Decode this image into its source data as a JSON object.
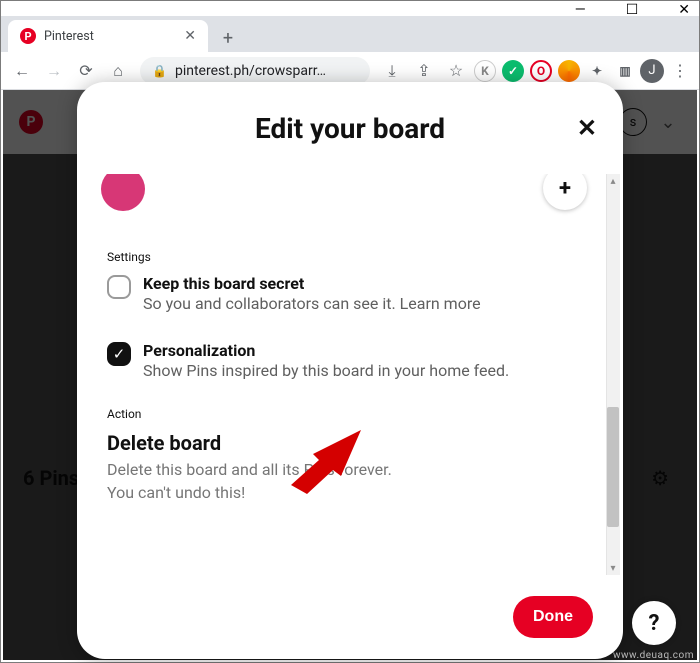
{
  "window": {
    "minimize": "—",
    "maximize": "☐",
    "close": "✕"
  },
  "tab": {
    "title": "Pinterest",
    "favicon_letter": "P"
  },
  "nav": {
    "url_display": "pinterest.ph/crowsparr…",
    "avatar_letter": "J"
  },
  "page_bg": {
    "logo_letter": "P",
    "badge_letter": "s",
    "pin_count_label": "6 Pins",
    "help_symbol": "?"
  },
  "modal": {
    "title": "Edit your board",
    "close_symbol": "✕",
    "collab_add_symbol": "+",
    "sections": {
      "settings_label": "Settings",
      "secret": {
        "title": "Keep this board secret",
        "desc": "So you and collaborators can see it. Learn more"
      },
      "personalization": {
        "title": "Personalization",
        "desc": "Show Pins inspired by this board in your home feed.",
        "check_symbol": "✓"
      },
      "action_label": "Action",
      "delete": {
        "title": "Delete board",
        "desc_line1": "Delete this board and all its Pins forever.",
        "desc_line2": "You can't undo this!"
      }
    },
    "done_label": "Done"
  },
  "watermark": "www.deuaq.com"
}
